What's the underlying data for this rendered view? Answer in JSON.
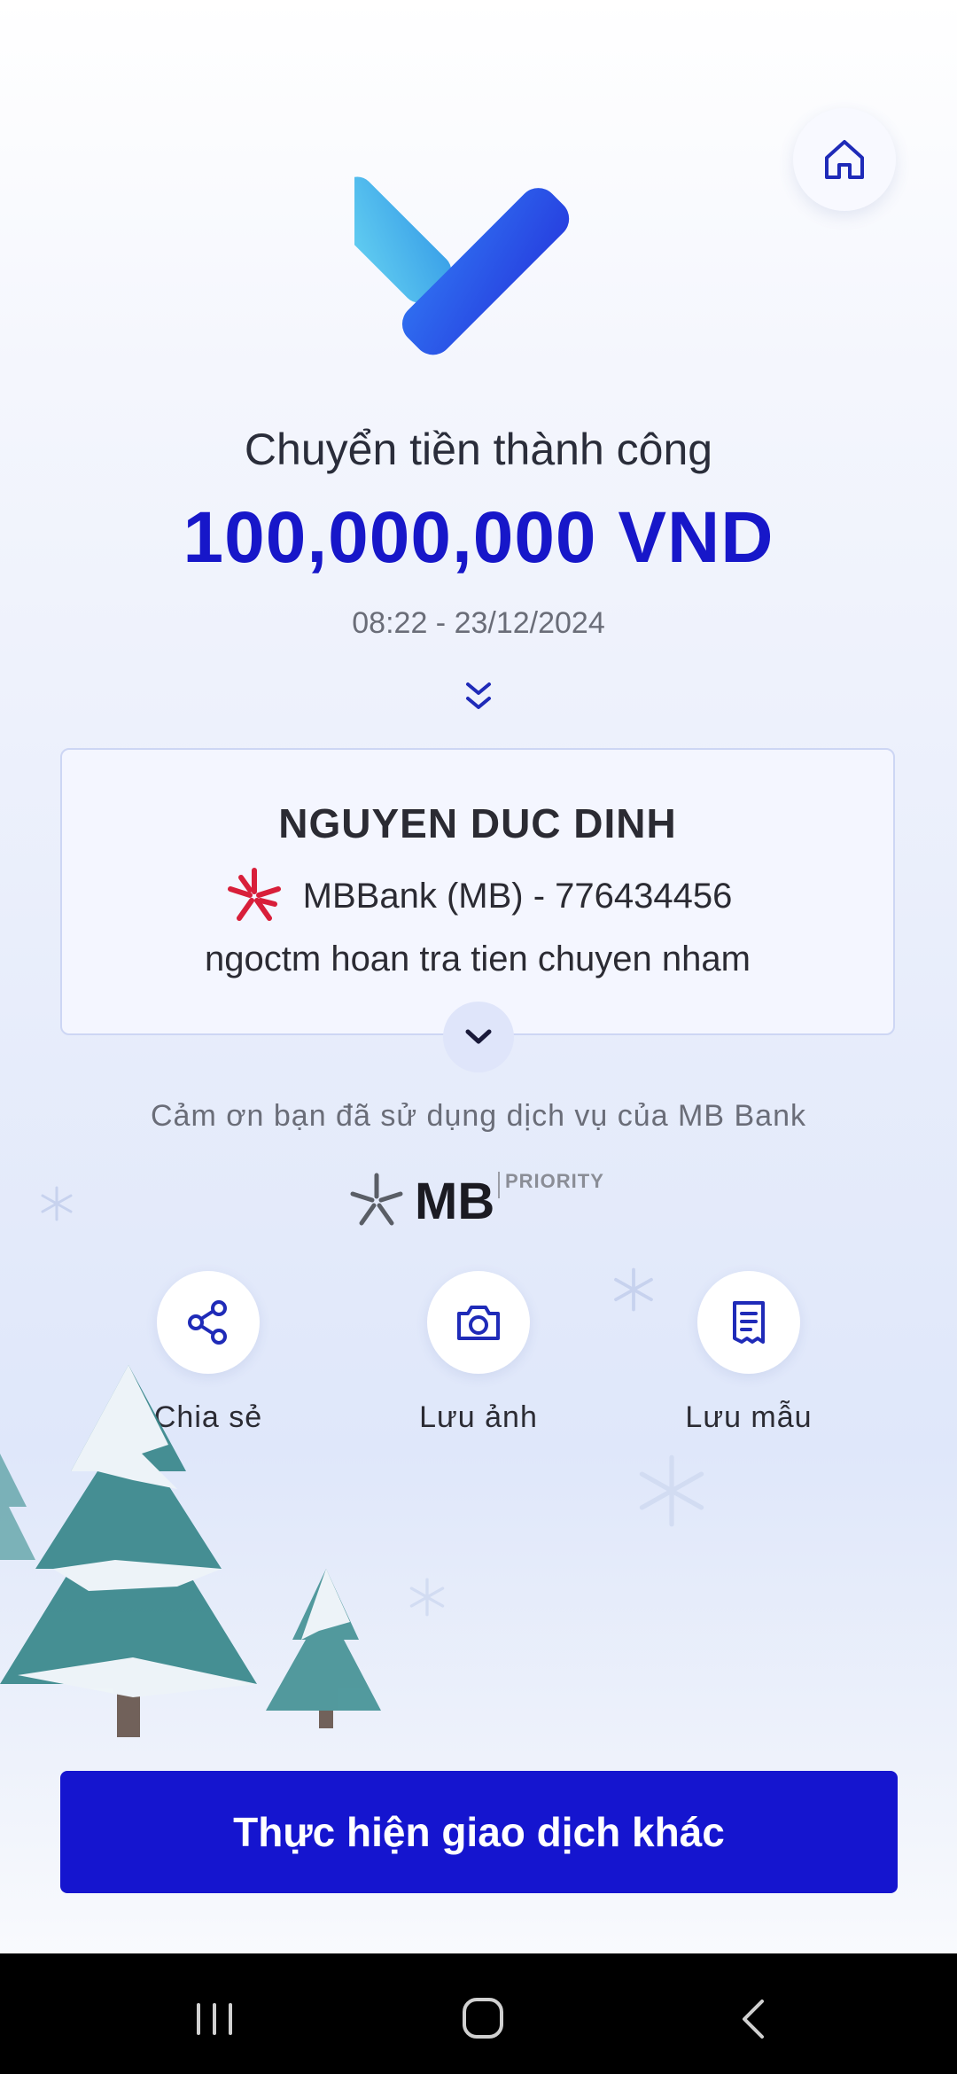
{
  "header": {
    "home_icon": "home-icon"
  },
  "result": {
    "title": "Chuyển tiền thành công",
    "amount": "100,000,000 VND",
    "datetime": "08:22 - 23/12/2024"
  },
  "card": {
    "recipient_name": "NGUYEN DUC DINH",
    "bank_account": "MBBank (MB) - 776434456",
    "note": "ngoctm hoan tra tien chuyen nham"
  },
  "footer_text": "Cảm ơn bạn đã sử dụng dịch vụ của MB Bank",
  "brand": {
    "logo_text": "MB",
    "logo_tag": "PRIORITY"
  },
  "actions": [
    {
      "label": "Chia sẻ",
      "icon": "share-icon"
    },
    {
      "label": "Lưu ảnh",
      "icon": "camera-icon"
    },
    {
      "label": "Lưu mẫu",
      "icon": "receipt-icon"
    }
  ],
  "cta": {
    "label": "Thực hiện giao dịch khác"
  },
  "colors": {
    "primary": "#1515CF",
    "amount": "#1717C9",
    "check_light": "#5CCBF0",
    "check_dark": "#2A4BE8"
  }
}
